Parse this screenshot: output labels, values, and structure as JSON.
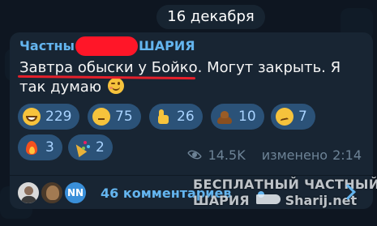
{
  "date_separator": "16 декабря",
  "post": {
    "channel_name_start": "Частны",
    "channel_name_end": "ШАРИЯ",
    "text_main": "Завтра обыски у Бойко. Могут закрыть. Я так думаю",
    "text_emoji": "winking-face-with-tongue"
  },
  "reactions": [
    {
      "icon": "grinning-face-icon",
      "count": "229"
    },
    {
      "icon": "thinking-face-icon",
      "count": "75"
    },
    {
      "icon": "thumbs-up-icon",
      "count": "26"
    },
    {
      "icon": "pile-of-poo-icon",
      "count": "10"
    },
    {
      "icon": "woozy-face-icon",
      "count": "7"
    },
    {
      "icon": "fire-icon",
      "count": "3"
    },
    {
      "icon": "party-popper-icon",
      "count": "2"
    }
  ],
  "meta": {
    "views": "14.5K",
    "edited": "изменено",
    "time": "2:14"
  },
  "comments": {
    "avatar3_initials": "NN",
    "label": "46 комментариев"
  },
  "watermark": {
    "line1": "БЕСПЛАТНЫЙ ЧАСТНЫЙ",
    "line2_a": "ШАРИЯ",
    "line2_b": "Sharij.net"
  },
  "colors": {
    "background": "#0e1621",
    "bubble": "#182533",
    "accent": "#64b5ef",
    "reaction_chip": "#2b5278",
    "redaction": "#ff1628"
  }
}
